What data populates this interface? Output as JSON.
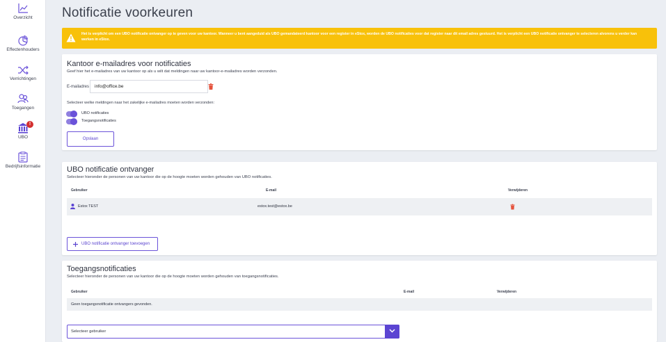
{
  "sidebar": {
    "items": [
      {
        "label": "Overzicht",
        "icon": "chart-line-icon"
      },
      {
        "label": "Effectenhouders",
        "icon": "pie-chart-icon"
      },
      {
        "label": "Verrichtingen",
        "icon": "shuffle-icon"
      },
      {
        "label": "Toegangen",
        "icon": "users-icon"
      },
      {
        "label": "UBO",
        "icon": "bank-icon",
        "badge": "!"
      },
      {
        "label": "Bedrijfsinformatie",
        "icon": "document-icon"
      }
    ]
  },
  "page": {
    "title": "Notificatie voorkeuren"
  },
  "alert": {
    "text": "Het is verplicht om een UBO notificatie ontvanger op te geven voor uw kantoor. Wanneer u bent aangeduid als UBO gemandateerd kantoor voor een register in eStox, worden de UBO notificaties voor dat register naar dit email adres gestuurd. Het is verplicht een UBO notificatie ontvanger te selecteren alvorens u verder kan werken in eStox."
  },
  "email_card": {
    "title": "Kantoor e-mailadres voor notificaties",
    "subtitle": "Geef hier het e-mailadres van uw kantoor op als u wilt dat meldingen naar uw kantoor-e-mailadres worden verzonden.",
    "field_label": "E-mailadres",
    "email_value": "info@office.be",
    "select_text": "Selecteer welke meldingen naar het zakelijke e-mailadres moeten worden verzonden:",
    "toggles": [
      {
        "label": "UBO notificaties",
        "on": true
      },
      {
        "label": "Toegangsnotificaties",
        "on": true
      }
    ],
    "save_label": "Opslaan"
  },
  "ubo_card": {
    "title": "UBO notificatie ontvanger",
    "subtitle": "Selecteer hieronder de personen van uw kantoor die op de hoogte moeten worden gehouden van UBO notificaties.",
    "columns": [
      "Gebruiker",
      "E-mail",
      "Verwijderen"
    ],
    "rows": [
      {
        "user": "Estox TEST",
        "email": "estox.test@estox.be"
      }
    ],
    "add_label": "UBO notificatie ontvanger toevoegen"
  },
  "access_card": {
    "title": "Toegangsnotificaties",
    "subtitle": "Selecteer hieronder de personen van uw kantoor die op de hoogte moeten worden gehouden van toegangsnotificaties.",
    "columns": [
      "Gebruiker",
      "E-mail",
      "Verwijderen"
    ],
    "empty_text": "Geen toegangsnotificatie ontvangers gevonden.",
    "select_placeholder": "Selecteer gebruiker"
  },
  "colors": {
    "accent": "#6a52d9",
    "warning": "#f8c10a",
    "danger": "#e5533d"
  }
}
